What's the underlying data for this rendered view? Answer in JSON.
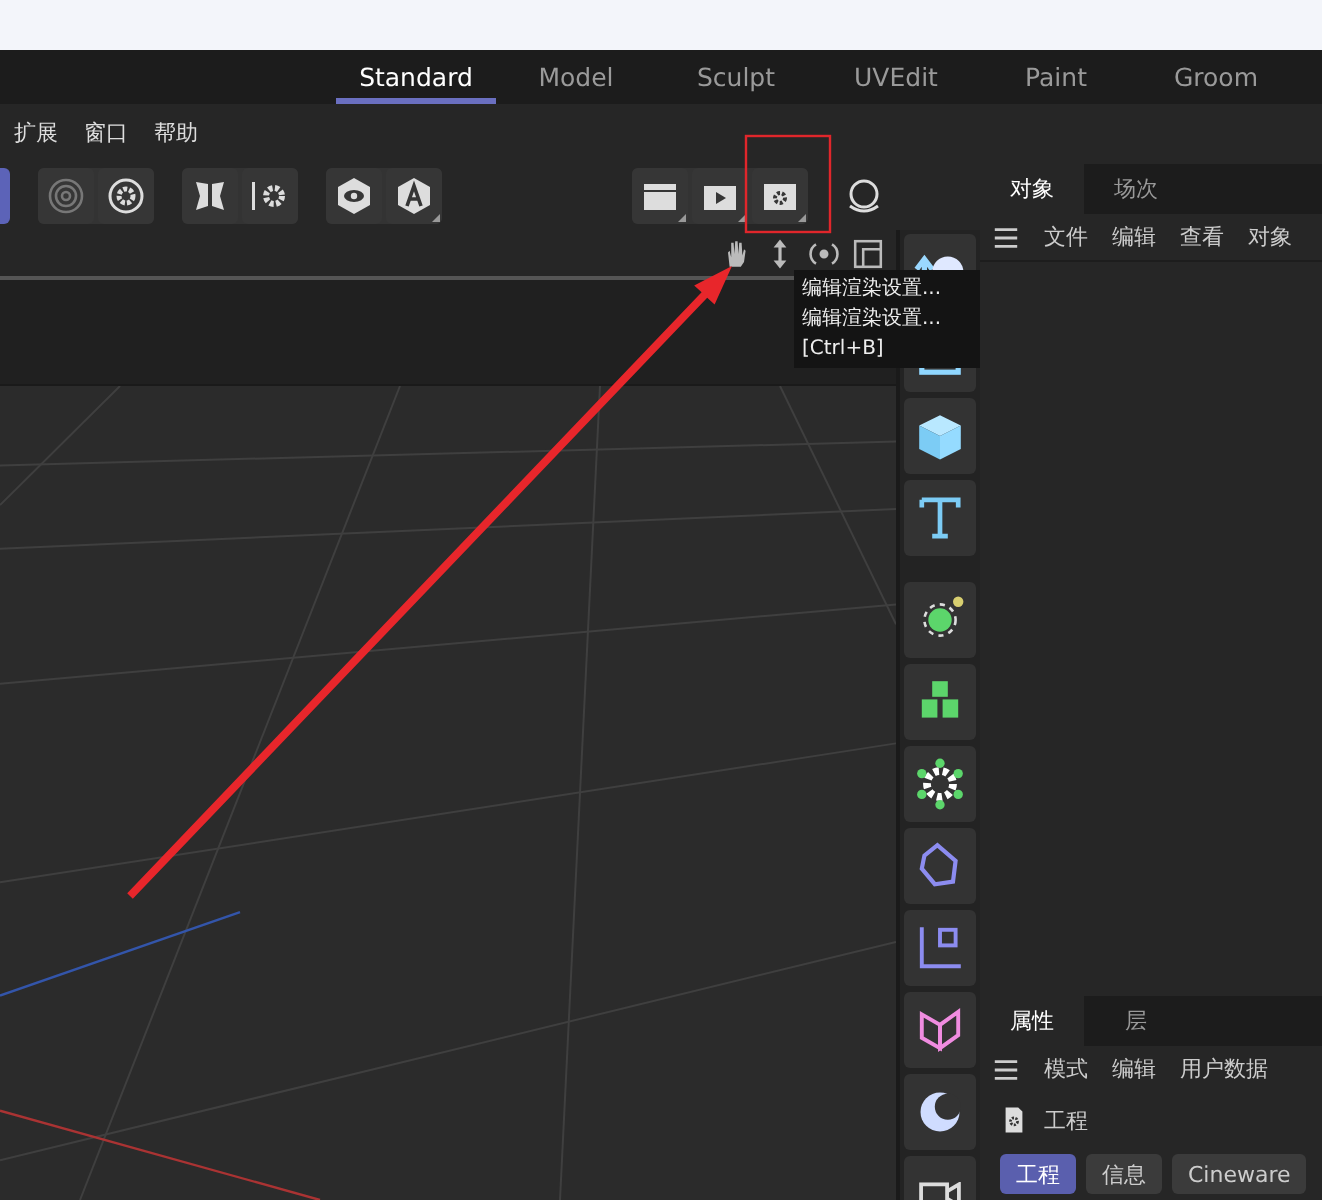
{
  "workspace_tabs": [
    {
      "label": "Standard",
      "selected": true
    },
    {
      "label": "Model",
      "selected": false
    },
    {
      "label": "Sculpt",
      "selected": false
    },
    {
      "label": "UVEdit",
      "selected": false
    },
    {
      "label": "Paint",
      "selected": false
    },
    {
      "label": "Groom",
      "selected": false
    }
  ],
  "menu_bar": [
    "扩展",
    "窗口",
    "帮助"
  ],
  "tooltip": [
    "编辑渲染设置...",
    "编辑渲染设置...",
    "[Ctrl+B]"
  ],
  "object_manager": {
    "tabs": [
      {
        "label": "对象",
        "selected": true
      },
      {
        "label": "场次",
        "selected": false
      }
    ],
    "menu": [
      "文件",
      "编辑",
      "查看",
      "对象"
    ]
  },
  "attribute_manager": {
    "tabs": [
      {
        "label": "属性",
        "selected": true
      },
      {
        "label": "层",
        "selected": false
      }
    ],
    "menu": [
      "模式",
      "编辑",
      "用户数据"
    ],
    "title": "工程",
    "buttons": [
      {
        "label": "工程",
        "selected": true
      },
      {
        "label": "信息",
        "selected": false
      },
      {
        "label": "Cineware",
        "selected": false
      }
    ]
  }
}
